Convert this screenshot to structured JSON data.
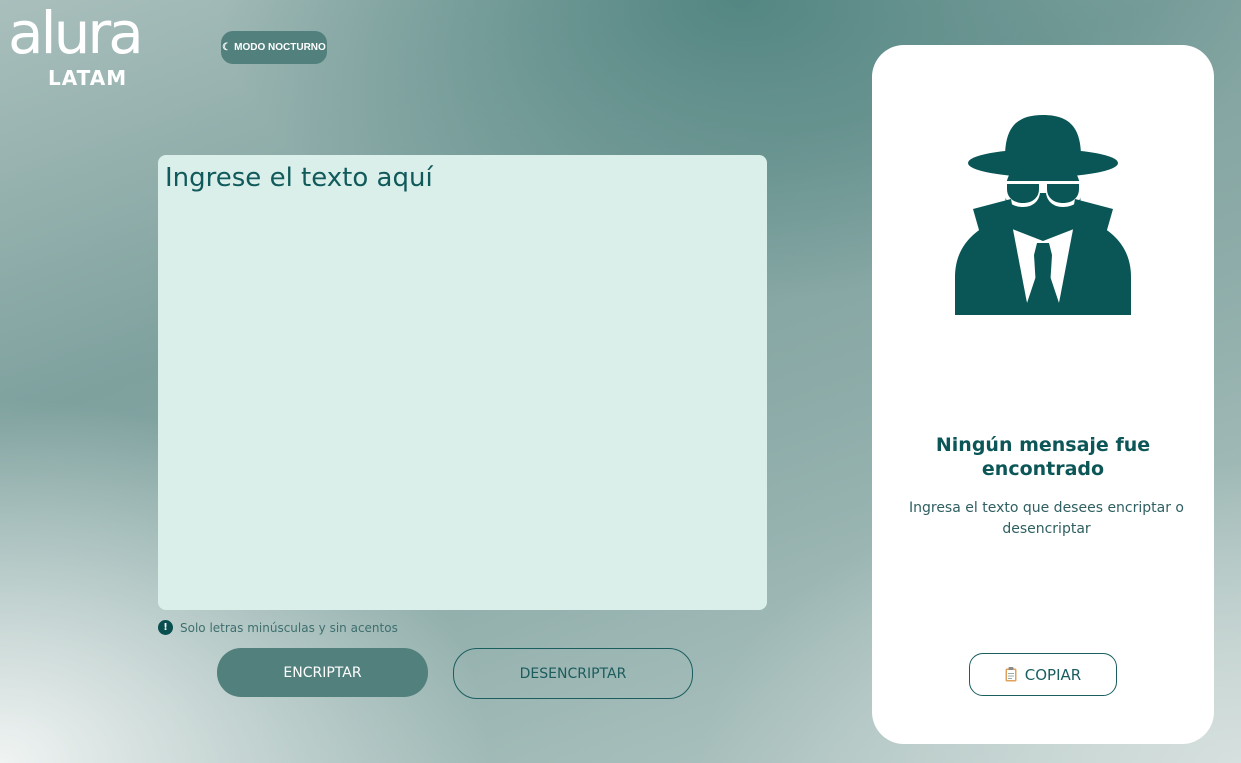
{
  "logo": {
    "word": "alura",
    "sub": "LATAM"
  },
  "night_mode": {
    "icon": "moon-icon",
    "label": "MODO NOCTURNO"
  },
  "input": {
    "placeholder": "Ingrese el texto aquí",
    "value": ""
  },
  "hint": {
    "icon": "exclamation-icon",
    "text": "Solo letras minúsculas y sin acentos"
  },
  "actions": {
    "encrypt_label": "ENCRIPTAR",
    "decrypt_label": "DESENCRIPTAR"
  },
  "output": {
    "illustration": "detective-icon",
    "title": "Ningún mensaje fue encontrado",
    "subtitle": "Ingresa el texto que desees encriptar o desencriptar",
    "copy_label": "COPIAR",
    "copy_icon": "clipboard-icon"
  },
  "colors": {
    "primary": "#0A4F50",
    "button_fill": "#52807D",
    "textarea_bg": "#DAEFEA",
    "card_bg": "#FFFFFF"
  }
}
